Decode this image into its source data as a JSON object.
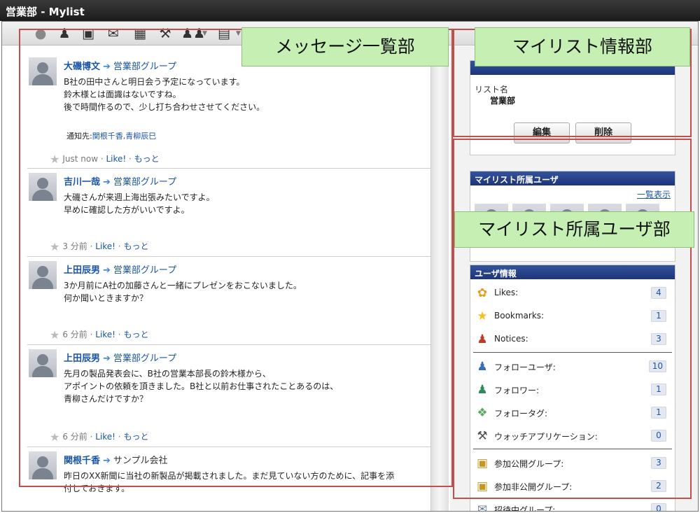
{
  "window": {
    "title": "営業部 - Mylist"
  },
  "toolbar": {
    "icons": [
      "lightbulb-icon",
      "user-icon",
      "book-icon",
      "mail-icon",
      "calculator-icon",
      "tools-icon",
      "group-icon",
      "form-icon"
    ]
  },
  "messages": [
    {
      "author": "大磯博文",
      "group": "営業部グループ",
      "lines": [
        "B社の田中さんと明日会う予定になっています。",
        "鈴木様とは面識はないですね。",
        "後で時間作るので、少し打ち合わせさせてください。"
      ],
      "notify_label": "通知先:",
      "notify_names": "関根千香,青柳辰巳",
      "time": "Just now",
      "like": "Like!",
      "more": "もっと"
    },
    {
      "author": "吉川一哉",
      "group": "営業部グループ",
      "lines": [
        "大磯さんが来週上海出張みたいですよ。",
        "早めに確認した方がいいですよ。"
      ],
      "time": "3 分前",
      "like": "Like!",
      "more": "もっと"
    },
    {
      "author": "上田辰男",
      "group": "営業部グループ",
      "lines": [
        "3か月前にA社の加藤さんと一緒にプレゼンをおこないました。",
        "何か聞いときますか？"
      ],
      "time": "6 分前",
      "like": "Like!",
      "more": "もっと"
    },
    {
      "author": "上田辰男",
      "group": "営業部グループ",
      "lines": [
        "先月の製品発表会に、B社の営業本部長の鈴木様から、",
        "アポイントの依頼を頂きました。B社と以前お仕事されたことあるのは、",
        "青柳さんだけですか？"
      ],
      "time": "6 分前",
      "like": "Like!",
      "more": "もっと"
    },
    {
      "author": "関根千香",
      "group": "サンプル会社",
      "lines": [
        "昨日のXX新聞に当社の新製品が掲載されました。まだ見ていない方のために、記事を添",
        "付しておきます。"
      ]
    }
  ],
  "mylist_info": {
    "list_name_label": "リスト名",
    "list_name": "営業部",
    "edit_button": "編集",
    "delete_button": "削除"
  },
  "members": {
    "title": "マイリスト所属ユーザ",
    "view_all": "一覧表示",
    "count_shown": 5
  },
  "user_info": {
    "title": "ユーザ情報",
    "stats": [
      {
        "icon": "flower-icon",
        "label": "Likes:",
        "count": "4"
      },
      {
        "icon": "star-icon",
        "label": "Bookmarks:",
        "count": "1"
      },
      {
        "icon": "notice-users-icon",
        "label": "Notices:",
        "count": "3"
      },
      {
        "icon": "follow-user-icon",
        "label": "フォローユーザ:",
        "count": "10"
      },
      {
        "icon": "follower-icon",
        "label": "フォロワー:",
        "count": "1"
      },
      {
        "icon": "tag-icon",
        "label": "フォロータグ:",
        "count": "1"
      },
      {
        "icon": "tools-icon",
        "label": "ウォッチアプリケーション:",
        "count": "0"
      },
      {
        "icon": "unlock-icon",
        "label": "参加公開グループ:",
        "count": "3"
      },
      {
        "icon": "lock-icon",
        "label": "参加非公開グループ:",
        "count": "2"
      },
      {
        "icon": "invite-icon",
        "label": "招待中グループ:",
        "count": "0"
      }
    ]
  },
  "callouts": {
    "messages": "メッセージ一覧部",
    "mylist_info": "マイリスト情報部",
    "members": "マイリスト所属ユーザ部"
  },
  "colors": {
    "annotation_outline": "#c0504d",
    "callout_bg": "#c6efb4",
    "box_header": "#1d3478",
    "link": "#1a55a8"
  }
}
